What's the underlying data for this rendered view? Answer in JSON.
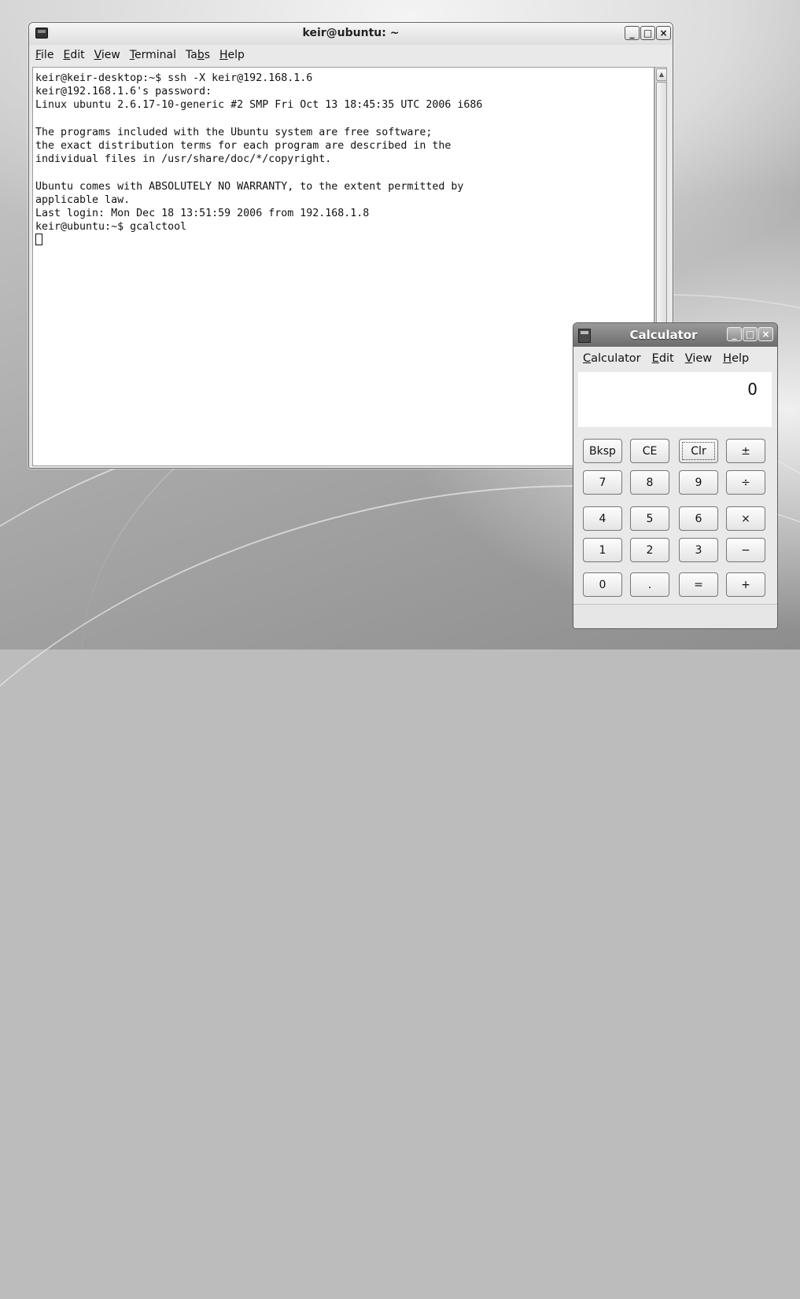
{
  "terminal": {
    "title": "keir@ubuntu: ~",
    "menu": [
      {
        "mnemonic": "F",
        "rest": "ile"
      },
      {
        "mnemonic": "E",
        "rest": "dit"
      },
      {
        "mnemonic": "V",
        "rest": "iew"
      },
      {
        "mnemonic": "T",
        "rest": "erminal"
      },
      {
        "pre": "Ta",
        "mnemonic": "b",
        "rest": "s"
      },
      {
        "mnemonic": "H",
        "rest": "elp"
      }
    ],
    "lines": [
      "keir@keir-desktop:~$ ssh -X keir@192.168.1.6",
      "keir@192.168.1.6's password:",
      "Linux ubuntu 2.6.17-10-generic #2 SMP Fri Oct 13 18:45:35 UTC 2006 i686",
      "",
      "The programs included with the Ubuntu system are free software;",
      "the exact distribution terms for each program are described in the",
      "individual files in /usr/share/doc/*/copyright.",
      "",
      "Ubuntu comes with ABSOLUTELY NO WARRANTY, to the extent permitted by",
      "applicable law.",
      "Last login: Mon Dec 18 13:51:59 2006 from 192.168.1.8",
      "keir@ubuntu:~$ gcalctool"
    ],
    "window_buttons": [
      "_",
      "□",
      "×"
    ]
  },
  "calculator": {
    "title": "Calculator",
    "menu": [
      {
        "mnemonic": "C",
        "rest": "alculator"
      },
      {
        "mnemonic": "E",
        "rest": "dit"
      },
      {
        "mnemonic": "V",
        "rest": "iew"
      },
      {
        "mnemonic": "H",
        "rest": "elp"
      }
    ],
    "display": "0",
    "window_buttons": [
      "_",
      "□",
      "×"
    ],
    "keys": [
      [
        "Bksp",
        "CE",
        "Clr",
        "±"
      ],
      [
        "7",
        "8",
        "9",
        "÷"
      ],
      [
        "4",
        "5",
        "6",
        "×"
      ],
      [
        "1",
        "2",
        "3",
        "−"
      ],
      [
        "0",
        ".",
        "=",
        "+"
      ]
    ],
    "focused_key": "Clr"
  }
}
